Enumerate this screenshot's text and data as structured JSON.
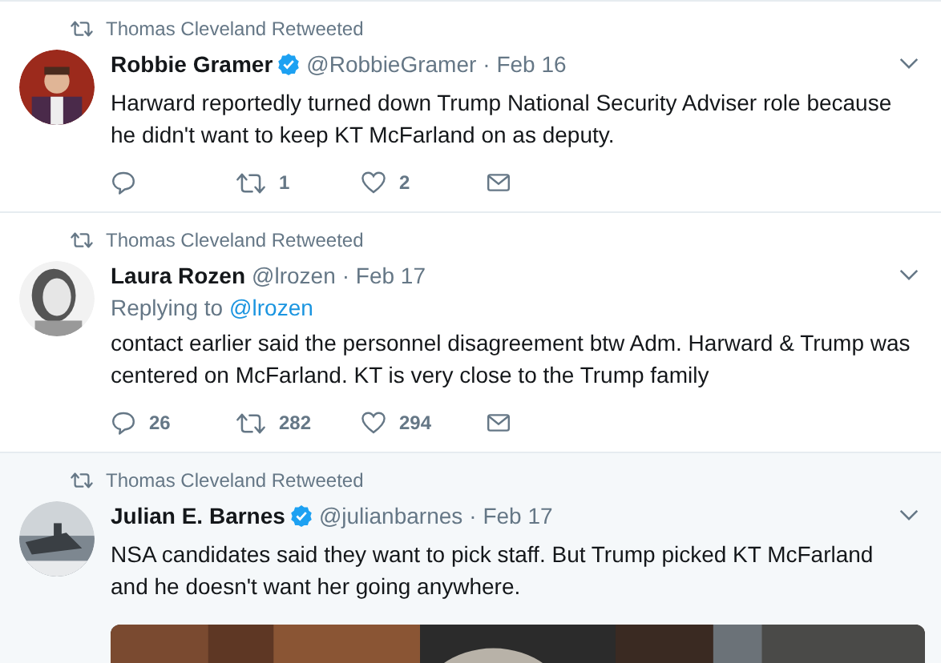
{
  "tweets": [
    {
      "retweeted_by": "Thomas Cleveland Retweeted",
      "name": "Robbie Gramer",
      "verified": true,
      "handle": "@RobbieGramer",
      "date": "· Feb 16",
      "highlighted": false,
      "text": "Harward reportedly turned down Trump National Security Adviser role because he didn't want to keep KT McFarland on as deputy.",
      "actions": [
        {
          "kind": "reply"
        },
        {
          "kind": "retweet",
          "count": "1"
        },
        {
          "kind": "like",
          "count": "2"
        },
        {
          "kind": "message"
        }
      ]
    },
    {
      "retweeted_by": "Thomas Cleveland Retweeted",
      "name": "Laura Rozen",
      "verified": false,
      "handle": "@lrozen",
      "date": "· Feb 17",
      "highlighted": false,
      "replying_label": "Replying to",
      "replying_to": "@lrozen",
      "text": "contact earlier said the personnel disagreement btw Adm. Harward & Trump was centered on McFarland. KT is very close to the Trump family",
      "actions": [
        {
          "kind": "reply",
          "count": "26"
        },
        {
          "kind": "retweet",
          "count": "282"
        },
        {
          "kind": "like",
          "count": "294"
        },
        {
          "kind": "message"
        }
      ]
    },
    {
      "retweeted_by": "Thomas Cleveland Retweeted",
      "name": "Julian E. Barnes",
      "verified": true,
      "handle": "@julianbarnes",
      "date": "· Feb 17",
      "highlighted": true,
      "text": "NSA candidates said they want to pick staff. But Trump picked KT McFarland and he doesn't want her going anywhere."
    }
  ]
}
